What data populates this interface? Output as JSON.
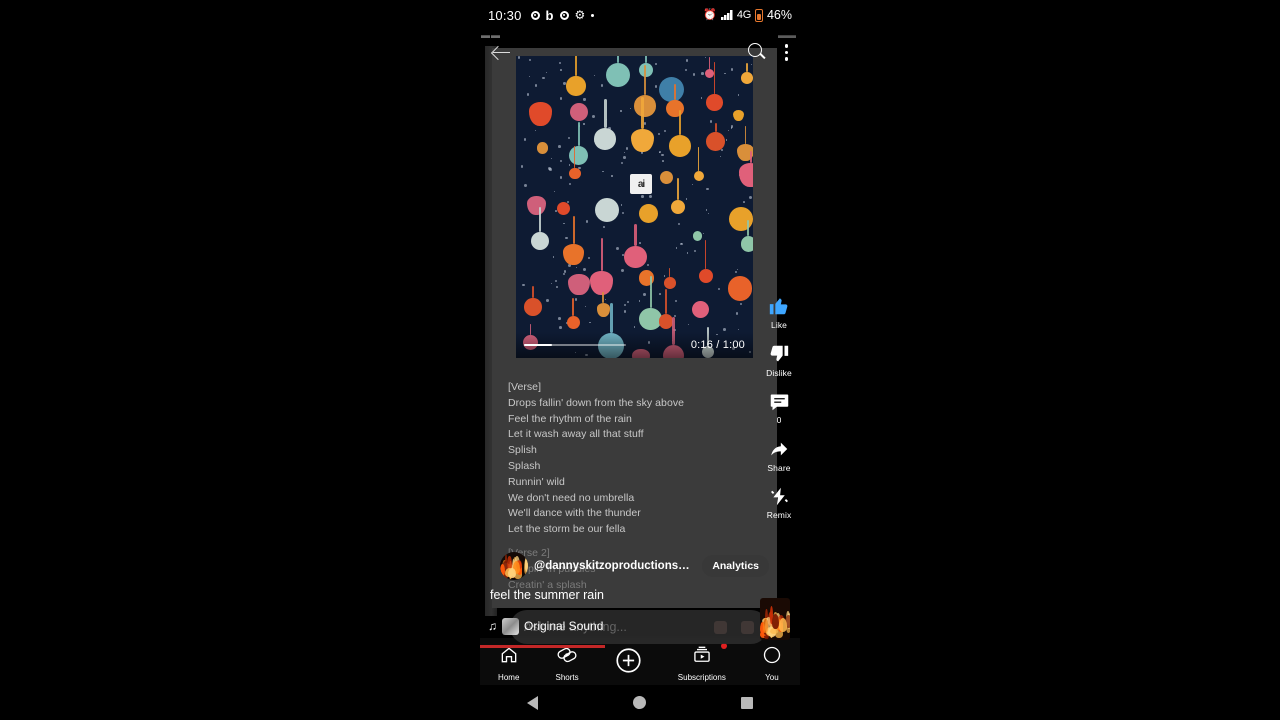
{
  "statusbar": {
    "clock": "10:30",
    "left_icons": [
      "camera-icon",
      "bixby-icon",
      "camera-icon",
      "gear-icon",
      "dot-icon"
    ],
    "alarm_icon": "alarm-icon",
    "signal_icon": "signal-bars-icon",
    "network": "4G",
    "battery_pct": "46%"
  },
  "header": {
    "back_icon": "back-arrow-icon",
    "search_icon": "search-icon",
    "menu_icon": "overflow-menu-icon",
    "ghost_left": "▬▬",
    "ghost_right": "▬▬"
  },
  "video": {
    "elapsed_total": "0:16 / 1:00",
    "progress_pct": 27,
    "watermark": "ai",
    "background_color": "#0e1b33"
  },
  "lyrics": {
    "lines": [
      "[Verse]",
      "Drops fallin' down from the sky above",
      "Feel the rhythm of the rain",
      "Let it wash away all that stuff",
      "Splish",
      "Splash",
      "Runnin' wild",
      "We don't need no umbrella",
      "We'll dance with the thunder",
      "Let the storm be our fella"
    ],
    "faded_lines": [
      "[Verse 2]",
      "Jumpin' in puddles",
      "Creatin' a splash"
    ]
  },
  "channel": {
    "handle": "@dannyskitzoproductionsuniv...",
    "avatar_icon": "fire-avatar",
    "analytics_label": "Analytics"
  },
  "caption": {
    "text": "feel the summer rain"
  },
  "sound": {
    "note_icon": "music-note-icon",
    "label": "Original Sound"
  },
  "ghost_search": {
    "placeholder": "Ask me anything...",
    "icons": [
      "image-icon",
      "mic-icon"
    ]
  },
  "rail": [
    {
      "icon": "thumbs-up-icon",
      "label": "Like",
      "color": "#3ea6ff"
    },
    {
      "icon": "thumbs-down-icon",
      "label": "Dislike",
      "color": "#ffffff"
    },
    {
      "icon": "comment-icon",
      "label": "0",
      "color": "#ffffff"
    },
    {
      "icon": "share-icon",
      "label": "Share",
      "color": "#ffffff"
    },
    {
      "icon": "remix-icon",
      "label": "Remix",
      "color": "#ffffff"
    }
  ],
  "bottom_nav": [
    {
      "icon": "home-icon",
      "label": "Home"
    },
    {
      "icon": "shorts-icon",
      "label": "Shorts"
    },
    {
      "icon": "plus-icon",
      "label": ""
    },
    {
      "icon": "subscriptions-icon",
      "label": "Subscriptions",
      "badge": true
    },
    {
      "icon": "you-icon",
      "label": "You"
    }
  ],
  "sysnav": {
    "back_icon": "system-back-icon",
    "home_icon": "system-home-icon",
    "recents_icon": "system-recents-icon"
  }
}
